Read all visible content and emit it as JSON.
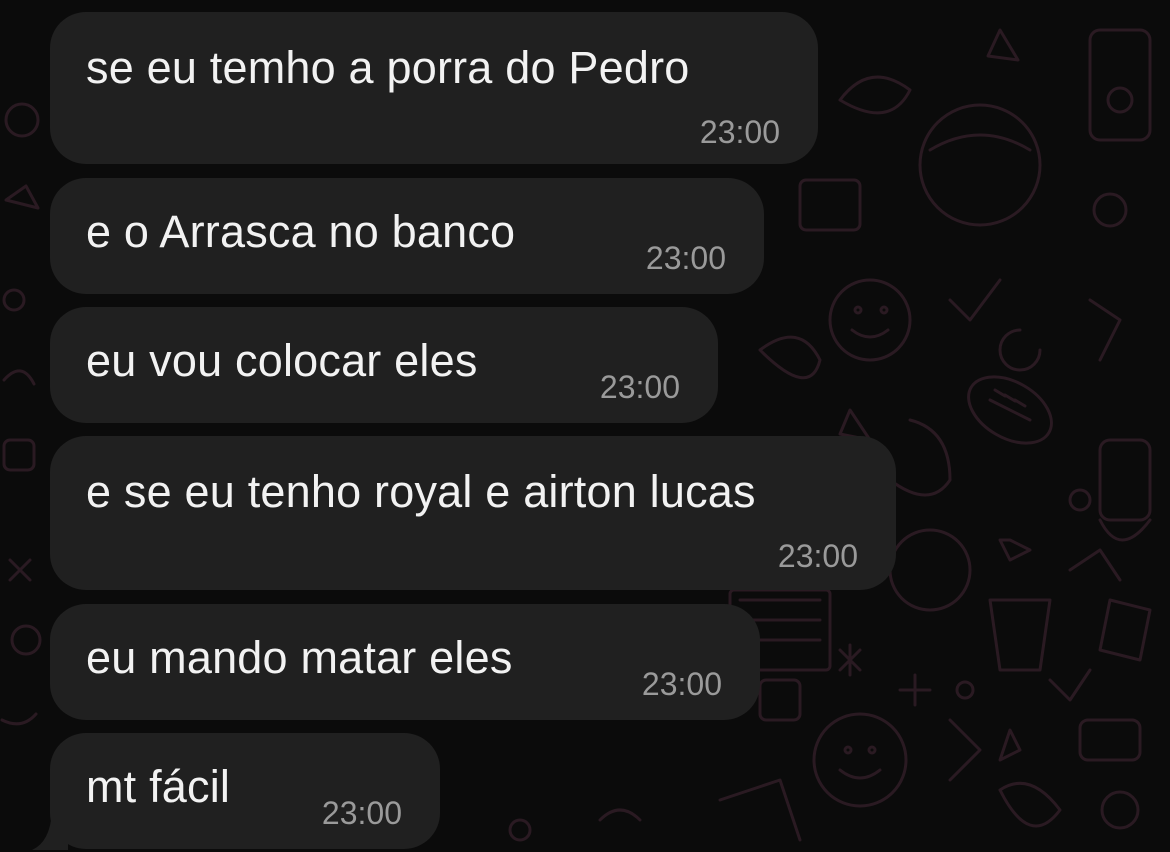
{
  "chat": {
    "messages": [
      {
        "text": "se eu temho a porra do Pedro",
        "time": "23:00"
      },
      {
        "text": "e o Arrasca no banco",
        "time": "23:00"
      },
      {
        "text": "eu vou colocar eles",
        "time": "23:00"
      },
      {
        "text": "e se eu tenho royal e airton lucas",
        "time": "23:00"
      },
      {
        "text": "eu mando matar eles",
        "time": "23:00"
      },
      {
        "text": "mt fácil",
        "time": "23:00"
      }
    ]
  },
  "theme": {
    "background": "#0b0b0b",
    "bubble": "#202020",
    "text": "#f2f2f2",
    "timestamp": "#9a9a9a",
    "doodle": "#2a1a22"
  }
}
